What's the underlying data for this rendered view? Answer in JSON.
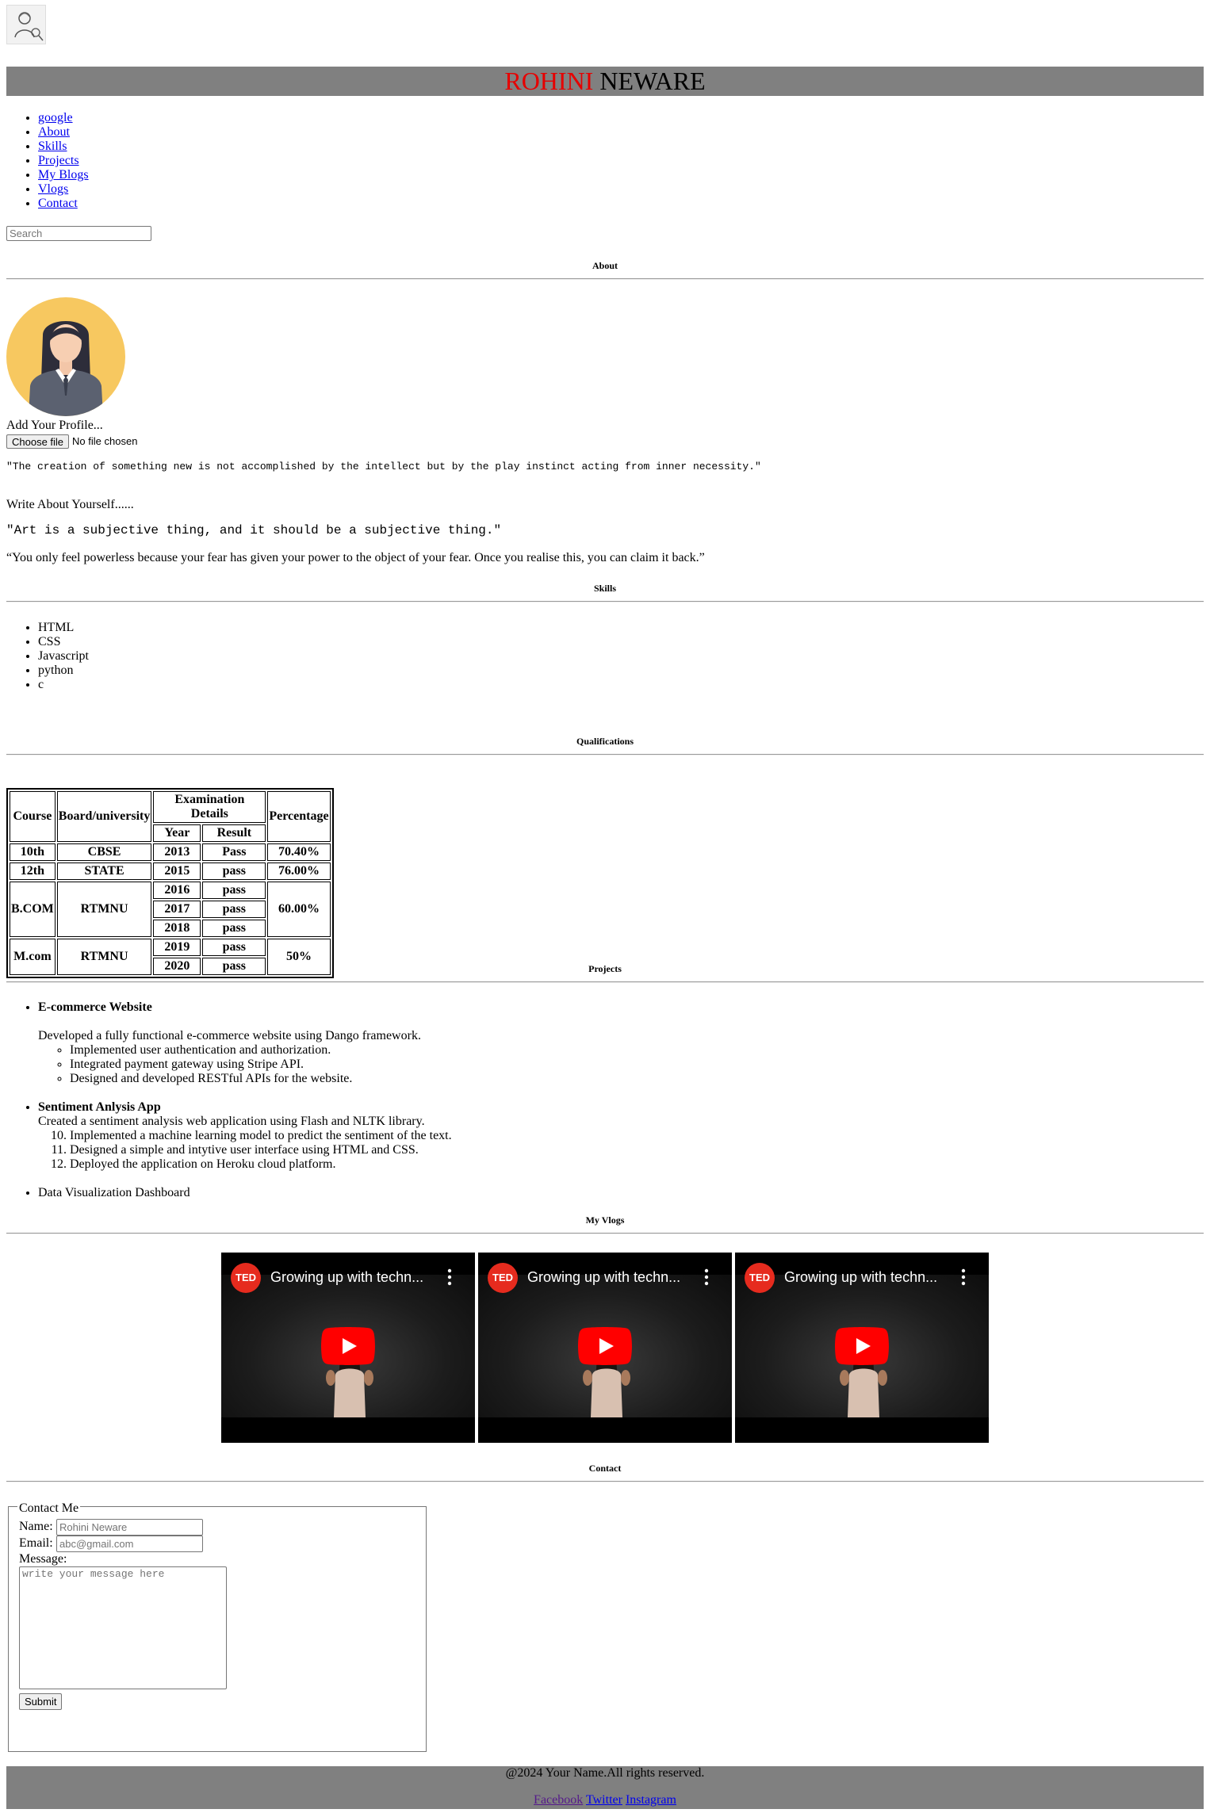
{
  "header": {
    "logo_icon": "person-sketch-icon",
    "title_first": "ROHINI",
    "title_last": "NEWARE",
    "title_first_color": "#e60000",
    "banner_color": "#808080"
  },
  "nav": {
    "items": [
      {
        "label": "google"
      },
      {
        "label": "About"
      },
      {
        "label": "Skills"
      },
      {
        "label": "Projects"
      },
      {
        "label": "My Blogs"
      },
      {
        "label": "Vlogs"
      },
      {
        "label": "Contact"
      }
    ],
    "search_placeholder": "Search"
  },
  "about": {
    "heading": "About",
    "avatar_icon": "woman-avatar-icon",
    "add_profile_label": "Add Your Profile...",
    "file_button": "Choose file",
    "file_status": "No file chosen",
    "quote1": "\"The creation of something new is not accomplished by the intellect but by the play instinct acting from inner necessity.\"",
    "write_about": "Write About Yourself......",
    "quote2": "\"Art is a subjective thing, and it should be a subjective thing.\"",
    "quote3": "“You only feel powerless because your fear has given your power to the object of your fear. Once you realise this, you can claim it back.”"
  },
  "skills": {
    "heading": "Skills",
    "items": [
      "HTML",
      "CSS",
      "Javascript",
      "python",
      "c"
    ]
  },
  "qualifications": {
    "heading": "Qualifications",
    "headers": {
      "course": "Course",
      "board": "Board/university",
      "exam": "Examination Details",
      "year": "Year",
      "result": "Result",
      "percentage": "Percentage"
    },
    "rows": [
      {
        "course": "10th",
        "board": "CBSE",
        "year": "2013",
        "result": "Pass",
        "percentage": "70.40%"
      },
      {
        "course": "12th",
        "board": "STATE",
        "year": "2015",
        "result": "pass",
        "percentage": "76.00%"
      },
      {
        "course": "B.COM",
        "board": "RTMNU",
        "years": [
          "2016",
          "2017",
          "2018"
        ],
        "results": [
          "pass",
          "pass",
          "pass"
        ],
        "percentage": "60.00%"
      },
      {
        "course": "M.com",
        "board": "RTMNU",
        "years": [
          "2019",
          "2020"
        ],
        "results": [
          "pass",
          "pass"
        ],
        "percentage": "50%"
      }
    ]
  },
  "projects": {
    "heading": "Projects",
    "items": [
      {
        "title": "E-commerce Website",
        "description": "Developed a fully functional e-commerce website using Dango framework.",
        "points": [
          "Implemented user authentication and authorization.",
          "Integrated payment gateway using Stripe API.",
          "Designed and developed RESTful APIs for the website."
        ]
      },
      {
        "title": "Sentiment Anlysis App",
        "description": "Created a sentiment analysis web application using Flash and NLTK library.",
        "points": [
          "Implemented a machine learning model to predict the sentiment of the text.",
          "Designed a simple and intytive user interface using HTML and CSS.",
          "Deployed the application on Heroku cloud platform."
        ],
        "start": 10
      },
      {
        "title": "Data Visualization Dashboard"
      }
    ]
  },
  "vlogs": {
    "heading": "My Vlogs",
    "videos": [
      {
        "title": "Growing up with techn...",
        "badge": "TED"
      },
      {
        "title": "Growing up with techn...",
        "badge": "TED"
      },
      {
        "title": "Growing up with techn...",
        "badge": "TED"
      }
    ]
  },
  "contact": {
    "heading": "Contact",
    "legend": "Contact Me",
    "name_label": "Name:",
    "name_placeholder": "Rohini Neware",
    "email_label": "Email:",
    "email_placeholder": "abc@gmail.com",
    "message_label": "Message:",
    "message_placeholder": "write your message here",
    "submit_label": "Submit"
  },
  "footer": {
    "copyright": "@2024 Your Name.All rights reserved.",
    "links": [
      "Facebook",
      "Twitter",
      "Instagram"
    ]
  }
}
